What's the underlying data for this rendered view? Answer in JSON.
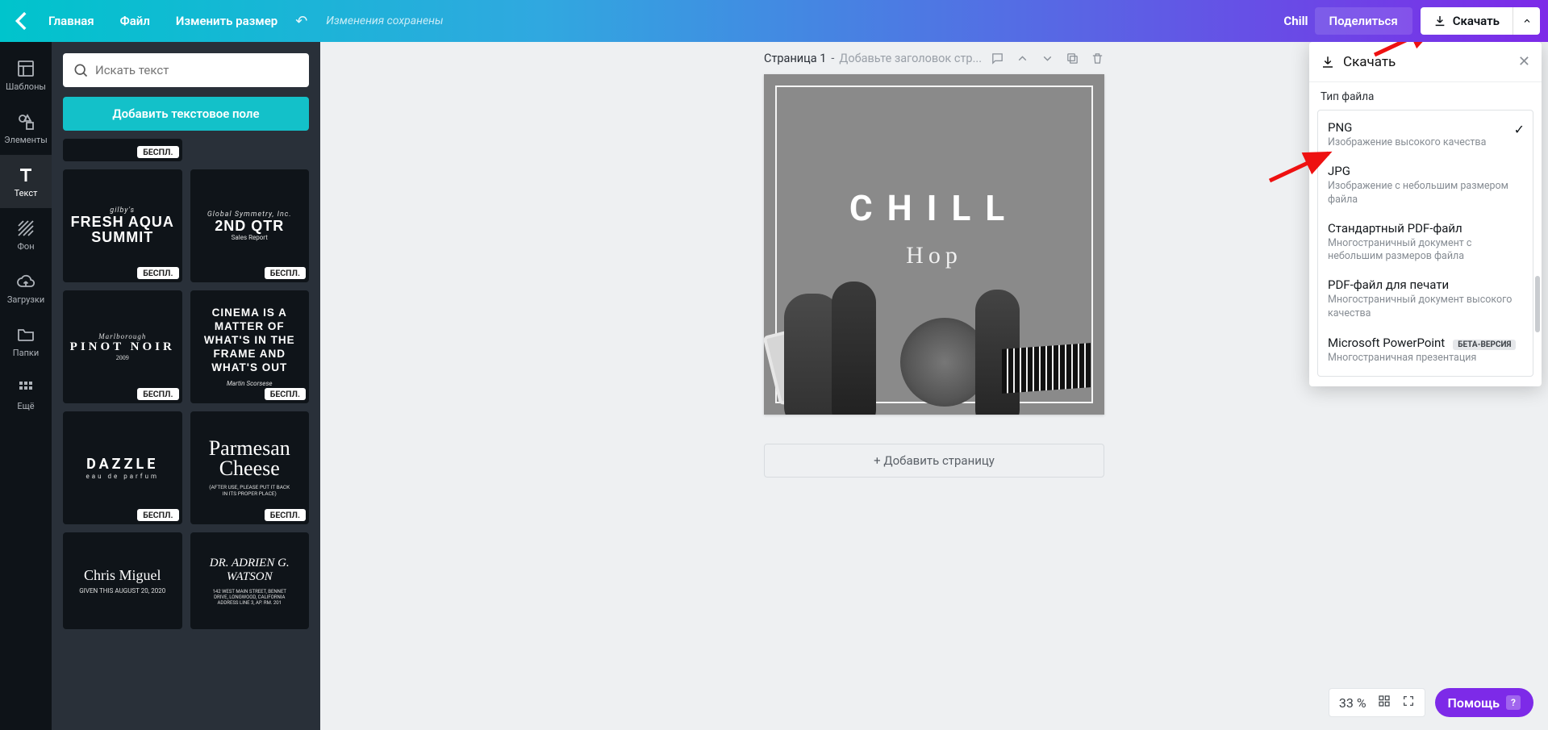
{
  "topbar": {
    "home": "Главная",
    "file": "Файл",
    "resize": "Изменить размер",
    "saved": "Изменения сохранены",
    "project": "Chill",
    "share": "Поделиться",
    "download": "Скачать"
  },
  "rail": {
    "templates": "Шаблоны",
    "elements": "Элементы",
    "text": "Текст",
    "background": "Фон",
    "uploads": "Загрузки",
    "folders": "Папки",
    "more": "Ещё"
  },
  "panel": {
    "search_placeholder": "Искать текст",
    "add_text": "Добавить текстовое поле",
    "free": "БЕСПЛ."
  },
  "templates": [
    {
      "l1": "gilby's",
      "big": "FRESH AQUA\nSUMMIT"
    },
    {
      "l1": "Global Symmetry, Inc.",
      "big": "2ND QTR",
      "sm": "Sales Report"
    },
    {
      "l1": "Marlborough",
      "big": "PINOT NOIR",
      "sm": "2009",
      "style": "serif spaced"
    },
    {
      "big": "CINEMA IS A MATTER OF WHAT'S IN THE FRAME AND WHAT'S OUT",
      "sm": "Martin Scorsese"
    },
    {
      "big": "DAZZLE",
      "sm": "eau de parfum",
      "style": "spaced"
    },
    {
      "script": "Parmesan\nCheese",
      "sm": "(AFTER USE, PLEASE PUT IT BACK\nIN ITS PROPER PLACE)"
    },
    {
      "serifBig": "Chris Miguel",
      "sm": "GIVEN THIS AUGUST 20, 2020"
    },
    {
      "serifItalic": "DR. ADRIEN G.\nWATSON",
      "sm": "142 WEST MAIN STREET, BENNET\nDRIVE, LONGWOOD, CALIFORNIA\nADDRESS LINE 3, AP. RM. 201"
    }
  ],
  "page": {
    "label": "Страница 1",
    "sep": " - ",
    "placeholder": "Добавьте заголовок стр...",
    "add_page": "+ Добавить страницу"
  },
  "artboard": {
    "title": "CHILL",
    "subtitle": "Hop"
  },
  "zoom": {
    "value": "33 %"
  },
  "help": "Помощь",
  "dlpop": {
    "title": "Скачать",
    "filetype_label": "Тип файла",
    "items": [
      {
        "t": "PNG",
        "d": "Изображение высокого качества",
        "selected": true
      },
      {
        "t": "JPG",
        "d": "Изображение с небольшим размером файла"
      },
      {
        "t": "Стандартный PDF-файл",
        "d": "Многостраничный документ с небольшим размеров файла"
      },
      {
        "t": "PDF-файл для печати",
        "d": "Многостраничный документ высокого качества"
      },
      {
        "t": "Microsoft PowerPoint",
        "d": "Многостраничная презентация",
        "beta": "БЕТА-ВЕРСИЯ"
      }
    ]
  }
}
